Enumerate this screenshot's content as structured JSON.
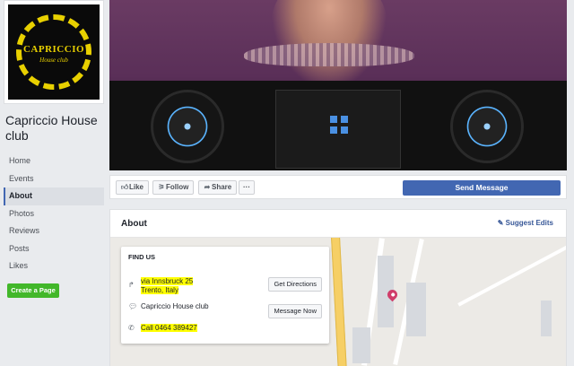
{
  "profile": {
    "logo_main": "CAPRICCIO",
    "logo_sub": "House club",
    "page_name": "Capriccio House club"
  },
  "sidebar": {
    "items": [
      {
        "label": "Home"
      },
      {
        "label": "Events"
      },
      {
        "label": "About",
        "active": true
      },
      {
        "label": "Photos"
      },
      {
        "label": "Reviews"
      },
      {
        "label": "Posts"
      },
      {
        "label": "Likes"
      }
    ],
    "create_page": "Create a Page"
  },
  "actions": {
    "like": "Like",
    "follow": "Follow",
    "share": "Share",
    "more": "···",
    "send_message": "Send Message"
  },
  "about": {
    "title": "About",
    "suggest_edits": "Suggest Edits",
    "find_us": {
      "title": "FIND US",
      "address_line1": "via Innsbruck 25",
      "address_line2": "Trento, Italy",
      "page_name": "Capriccio House club",
      "phone": "Call 0464 389427",
      "get_directions": "Get Directions",
      "message_now": "Message Now"
    }
  },
  "colors": {
    "accent": "#4267b2",
    "create_green": "#42b72a",
    "highlight": "#ffff00",
    "logo_gold": "#e8d000"
  }
}
